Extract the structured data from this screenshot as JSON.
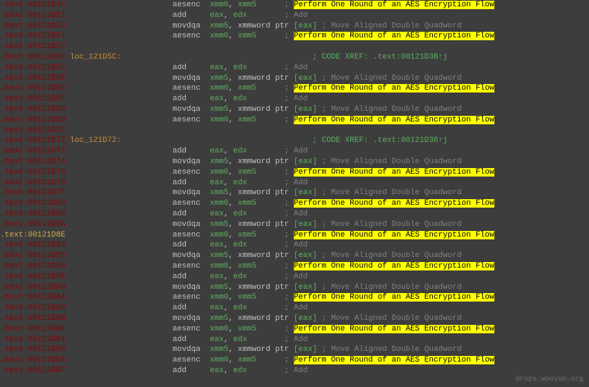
{
  "watermark": "drops.wooyun.org",
  "colAddr": 0,
  "colLoc": 130,
  "colMnem": 236,
  "colOps": 300,
  "colCmt": 440,
  "lines": [
    {
      "addr": ".text:00121D4C",
      "mnem": "aesenc",
      "ops": [
        {
          "t": "reg",
          "v": "xmm0"
        },
        {
          "t": "comma",
          "v": ", "
        },
        {
          "t": "reg",
          "v": "xmm5"
        }
      ],
      "cs": "      ; ",
      "hl": "Perform One Round of an AES Encryption Flow"
    },
    {
      "addr": ".text:00121D51",
      "mnem": "add",
      "ops": [
        {
          "t": "reg",
          "v": "eax"
        },
        {
          "t": "comma",
          "v": ", "
        },
        {
          "t": "reg",
          "v": "edx"
        }
      ],
      "cs": "        ; ",
      "cmt": "Add"
    },
    {
      "addr": ".text:00121D53",
      "mnem": "movdqa",
      "ops": [
        {
          "t": "reg",
          "v": "xmm5"
        },
        {
          "t": "comma",
          "v": ", "
        },
        {
          "t": "plain",
          "v": "xmmword ptr "
        },
        {
          "t": "br",
          "v": "["
        },
        {
          "t": "reg",
          "v": "eax"
        },
        {
          "t": "br",
          "v": "]"
        }
      ],
      "cs": " ; ",
      "cmt": "Move Aligned Double Quadword"
    },
    {
      "addr": ".text:00121D57",
      "mnem": "aesenc",
      "ops": [
        {
          "t": "reg",
          "v": "xmm0"
        },
        {
          "t": "comma",
          "v": ", "
        },
        {
          "t": "reg",
          "v": "xmm5"
        }
      ],
      "cs": "      ; ",
      "hl": "Perform One Round of an AES Encryption Flow"
    },
    {
      "addr": ".text:00121D5C",
      "blank": true
    },
    {
      "addr": ".text:00121D5C",
      "loc": "loc_121D5C:",
      "xref": "; CODE XREF: .text:00121D3B↑j"
    },
    {
      "addr": ".text:00121D5C",
      "mnem": "add",
      "ops": [
        {
          "t": "reg",
          "v": "eax"
        },
        {
          "t": "comma",
          "v": ", "
        },
        {
          "t": "reg",
          "v": "edx"
        }
      ],
      "cs": "        ; ",
      "cmt": "Add"
    },
    {
      "addr": ".text:00121D5E",
      "mnem": "movdqa",
      "ops": [
        {
          "t": "reg",
          "v": "xmm5"
        },
        {
          "t": "comma",
          "v": ", "
        },
        {
          "t": "plain",
          "v": "xmmword ptr "
        },
        {
          "t": "br",
          "v": "["
        },
        {
          "t": "reg",
          "v": "eax"
        },
        {
          "t": "br",
          "v": "]"
        }
      ],
      "cs": " ; ",
      "cmt": "Move Aligned Double Quadword"
    },
    {
      "addr": ".text:00121D62",
      "mnem": "aesenc",
      "ops": [
        {
          "t": "reg",
          "v": "xmm0"
        },
        {
          "t": "comma",
          "v": ", "
        },
        {
          "t": "reg",
          "v": "xmm5"
        }
      ],
      "cs": "      ; ",
      "hl": "Perform One Round of an AES Encryption Flow"
    },
    {
      "addr": ".text:00121D67",
      "mnem": "add",
      "ops": [
        {
          "t": "reg",
          "v": "eax"
        },
        {
          "t": "comma",
          "v": ", "
        },
        {
          "t": "reg",
          "v": "edx"
        }
      ],
      "cs": "        ; ",
      "cmt": "Add"
    },
    {
      "addr": ".text:00121D69",
      "mnem": "movdqa",
      "ops": [
        {
          "t": "reg",
          "v": "xmm5"
        },
        {
          "t": "comma",
          "v": ", "
        },
        {
          "t": "plain",
          "v": "xmmword ptr "
        },
        {
          "t": "br",
          "v": "["
        },
        {
          "t": "reg",
          "v": "eax"
        },
        {
          "t": "br",
          "v": "]"
        }
      ],
      "cs": " ; ",
      "cmt": "Move Aligned Double Quadword"
    },
    {
      "addr": ".text:00121D6D",
      "mnem": "aesenc",
      "ops": [
        {
          "t": "reg",
          "v": "xmm0"
        },
        {
          "t": "comma",
          "v": ", "
        },
        {
          "t": "reg",
          "v": "xmm5"
        }
      ],
      "cs": "      ; ",
      "hl": "Perform One Round of an AES Encryption Flow"
    },
    {
      "addr": ".text:00121D72",
      "blank": true
    },
    {
      "addr": ".text:00121D72",
      "loc": "loc_121D72:",
      "xref": "; CODE XREF: .text:00121D36↑j"
    },
    {
      "addr": ".text:00121D72",
      "mnem": "add",
      "ops": [
        {
          "t": "reg",
          "v": "eax"
        },
        {
          "t": "comma",
          "v": ", "
        },
        {
          "t": "reg",
          "v": "edx"
        }
      ],
      "cs": "        ; ",
      "cmt": "Add"
    },
    {
      "addr": ".text:00121D74",
      "mnem": "movdqa",
      "ops": [
        {
          "t": "reg",
          "v": "xmm5"
        },
        {
          "t": "comma",
          "v": ", "
        },
        {
          "t": "plain",
          "v": "xmmword ptr "
        },
        {
          "t": "br",
          "v": "["
        },
        {
          "t": "reg",
          "v": "eax"
        },
        {
          "t": "br",
          "v": "]"
        }
      ],
      "cs": " ; ",
      "cmt": "Move Aligned Double Quadword"
    },
    {
      "addr": ".text:00121D78",
      "mnem": "aesenc",
      "ops": [
        {
          "t": "reg",
          "v": "xmm0"
        },
        {
          "t": "comma",
          "v": ", "
        },
        {
          "t": "reg",
          "v": "xmm5"
        }
      ],
      "cs": "      ; ",
      "hl": "Perform One Round of an AES Encryption Flow"
    },
    {
      "addr": ".text:00121D7D",
      "mnem": "add",
      "ops": [
        {
          "t": "reg",
          "v": "eax"
        },
        {
          "t": "comma",
          "v": ", "
        },
        {
          "t": "reg",
          "v": "edx"
        }
      ],
      "cs": "        ; ",
      "cmt": "Add"
    },
    {
      "addr": ".text:00121D7F",
      "mnem": "movdqa",
      "ops": [
        {
          "t": "reg",
          "v": "xmm5"
        },
        {
          "t": "comma",
          "v": ", "
        },
        {
          "t": "plain",
          "v": "xmmword ptr "
        },
        {
          "t": "br",
          "v": "["
        },
        {
          "t": "reg",
          "v": "eax"
        },
        {
          "t": "br",
          "v": "]"
        }
      ],
      "cs": " ; ",
      "cmt": "Move Aligned Double Quadword"
    },
    {
      "addr": ".text:00121D83",
      "mnem": "aesenc",
      "ops": [
        {
          "t": "reg",
          "v": "xmm0"
        },
        {
          "t": "comma",
          "v": ", "
        },
        {
          "t": "reg",
          "v": "xmm5"
        }
      ],
      "cs": "      ; ",
      "hl": "Perform One Round of an AES Encryption Flow"
    },
    {
      "addr": ".text:00121D88",
      "mnem": "add",
      "ops": [
        {
          "t": "reg",
          "v": "eax"
        },
        {
          "t": "comma",
          "v": ", "
        },
        {
          "t": "reg",
          "v": "edx"
        }
      ],
      "cs": "        ; ",
      "cmt": "Add"
    },
    {
      "addr": ".text:00121D8A",
      "mnem": "movdqa",
      "ops": [
        {
          "t": "reg",
          "v": "xmm5"
        },
        {
          "t": "comma",
          "v": ", "
        },
        {
          "t": "plain",
          "v": "xmmword ptr "
        },
        {
          "t": "br",
          "v": "["
        },
        {
          "t": "reg",
          "v": "eax"
        },
        {
          "t": "br",
          "v": "]"
        }
      ],
      "cs": " ; ",
      "cmt": "Move Aligned Double Quadword"
    },
    {
      "addr": ".text:00121D8E",
      "hi": true,
      "mnem": "aesenc",
      "ops": [
        {
          "t": "reg",
          "v": "xmm0"
        },
        {
          "t": "comma",
          "v": ", "
        },
        {
          "t": "reg",
          "v": "xmm5"
        }
      ],
      "cs": "      ; ",
      "hl": "Perform One Round of an AES Encryption Flow"
    },
    {
      "addr": ".text:00121D93",
      "mnem": "add",
      "ops": [
        {
          "t": "reg",
          "v": "eax"
        },
        {
          "t": "comma",
          "v": ", "
        },
        {
          "t": "reg",
          "v": "edx"
        }
      ],
      "cs": "        ; ",
      "cmt": "Add"
    },
    {
      "addr": ".text:00121D95",
      "mnem": "movdqa",
      "ops": [
        {
          "t": "reg",
          "v": "xmm5"
        },
        {
          "t": "comma",
          "v": ", "
        },
        {
          "t": "plain",
          "v": "xmmword ptr "
        },
        {
          "t": "br",
          "v": "["
        },
        {
          "t": "reg",
          "v": "eax"
        },
        {
          "t": "br",
          "v": "]"
        }
      ],
      "cs": " ; ",
      "cmt": "Move Aligned Double Quadword"
    },
    {
      "addr": ".text:00121D99",
      "mnem": "aesenc",
      "ops": [
        {
          "t": "reg",
          "v": "xmm0"
        },
        {
          "t": "comma",
          "v": ", "
        },
        {
          "t": "reg",
          "v": "xmm5"
        }
      ],
      "cs": "      ; ",
      "hl": "Perform One Round of an AES Encryption Flow"
    },
    {
      "addr": ".text:00121D9E",
      "mnem": "add",
      "ops": [
        {
          "t": "reg",
          "v": "eax"
        },
        {
          "t": "comma",
          "v": ", "
        },
        {
          "t": "reg",
          "v": "edx"
        }
      ],
      "cs": "        ; ",
      "cmt": "Add"
    },
    {
      "addr": ".text:00121DA0",
      "mnem": "movdqa",
      "ops": [
        {
          "t": "reg",
          "v": "xmm5"
        },
        {
          "t": "comma",
          "v": ", "
        },
        {
          "t": "plain",
          "v": "xmmword ptr "
        },
        {
          "t": "br",
          "v": "["
        },
        {
          "t": "reg",
          "v": "eax"
        },
        {
          "t": "br",
          "v": "]"
        }
      ],
      "cs": " ; ",
      "cmt": "Move Aligned Double Quadword"
    },
    {
      "addr": ".text:00121DA4",
      "mnem": "aesenc",
      "ops": [
        {
          "t": "reg",
          "v": "xmm0"
        },
        {
          "t": "comma",
          "v": ", "
        },
        {
          "t": "reg",
          "v": "xmm5"
        }
      ],
      "cs": "      ; ",
      "hl": "Perform One Round of an AES Encryption Flow"
    },
    {
      "addr": ".text:00121DA9",
      "mnem": "add",
      "ops": [
        {
          "t": "reg",
          "v": "eax"
        },
        {
          "t": "comma",
          "v": ", "
        },
        {
          "t": "reg",
          "v": "edx"
        }
      ],
      "cs": "        ; ",
      "cmt": "Add"
    },
    {
      "addr": ".text:00121DAB",
      "mnem": "movdqa",
      "ops": [
        {
          "t": "reg",
          "v": "xmm5"
        },
        {
          "t": "comma",
          "v": ", "
        },
        {
          "t": "plain",
          "v": "xmmword ptr "
        },
        {
          "t": "br",
          "v": "["
        },
        {
          "t": "reg",
          "v": "eax"
        },
        {
          "t": "br",
          "v": "]"
        }
      ],
      "cs": " ; ",
      "cmt": "Move Aligned Double Quadword"
    },
    {
      "addr": ".text:00121DAF",
      "mnem": "aesenc",
      "ops": [
        {
          "t": "reg",
          "v": "xmm0"
        },
        {
          "t": "comma",
          "v": ", "
        },
        {
          "t": "reg",
          "v": "xmm5"
        }
      ],
      "cs": "      ; ",
      "hl": "Perform One Round of an AES Encryption Flow"
    },
    {
      "addr": ".text:00121DB4",
      "mnem": "add",
      "ops": [
        {
          "t": "reg",
          "v": "eax"
        },
        {
          "t": "comma",
          "v": ", "
        },
        {
          "t": "reg",
          "v": "edx"
        }
      ],
      "cs": "        ; ",
      "cmt": "Add"
    },
    {
      "addr": ".text:00121DB6",
      "mnem": "movdqa",
      "ops": [
        {
          "t": "reg",
          "v": "xmm5"
        },
        {
          "t": "comma",
          "v": ", "
        },
        {
          "t": "plain",
          "v": "xmmword ptr "
        },
        {
          "t": "br",
          "v": "["
        },
        {
          "t": "reg",
          "v": "eax"
        },
        {
          "t": "br",
          "v": "]"
        }
      ],
      "cs": " ; ",
      "cmt": "Move Aligned Double Quadword"
    },
    {
      "addr": ".text:00121DBA",
      "mnem": "aesenc",
      "ops": [
        {
          "t": "reg",
          "v": "xmm0"
        },
        {
          "t": "comma",
          "v": ", "
        },
        {
          "t": "reg",
          "v": "xmm5"
        }
      ],
      "cs": "      ; ",
      "hl": "Perform One Round of an AES Encryption Flow"
    },
    {
      "addr": ".text:00121DBF",
      "mnem": "add",
      "ops": [
        {
          "t": "reg",
          "v": "eax"
        },
        {
          "t": "comma",
          "v": ", "
        },
        {
          "t": "reg",
          "v": "edx"
        }
      ],
      "cs": "        ; ",
      "cmt": "Add"
    }
  ]
}
